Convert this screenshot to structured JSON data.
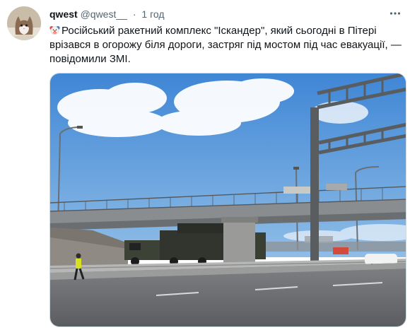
{
  "tweet": {
    "display_name": "qwest",
    "handle": "@qwest__",
    "separator": "·",
    "time": "1 год",
    "avatar_icon": "cat-avatar",
    "emoji_icon": "clown-face-icon",
    "text": "Російський ракетний комплекс \"Іскандер\", який сьогодні в Пітері врізався в огорожу біля дороги, застряг під мостом під час евакуації, — повідомили ЗМІ.",
    "more_icon": "more-horizontal-icon"
  },
  "colors": {
    "name": "#0f1419",
    "secondary": "#536471",
    "border": "#cfd9de",
    "sky": "#4f92d8"
  }
}
